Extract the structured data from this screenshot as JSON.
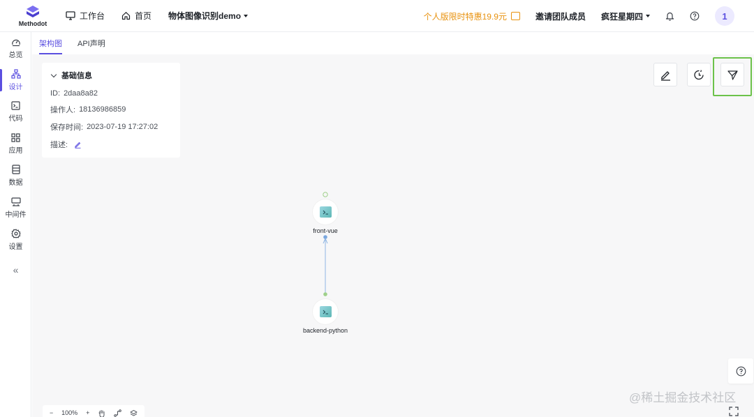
{
  "header": {
    "logo_text": "Methodot",
    "nav": [
      {
        "label": "工作台",
        "icon": "monitor-icon"
      },
      {
        "label": "首页",
        "icon": "home-icon"
      }
    ],
    "project": "物体图像识别demo",
    "promo": "个人版限时特惠19.9元",
    "invite": "邀请团队成员",
    "user_menu": "疯狂星期四",
    "avatar": "1"
  },
  "sidebar": {
    "items": [
      {
        "label": "总览",
        "icon": "dashboard-icon"
      },
      {
        "label": "设计",
        "icon": "architecture-icon"
      },
      {
        "label": "代码",
        "icon": "terminal-icon"
      },
      {
        "label": "应用",
        "icon": "apps-icon"
      },
      {
        "label": "数据",
        "icon": "database-icon"
      },
      {
        "label": "中间件",
        "icon": "middleware-icon"
      },
      {
        "label": "设置",
        "icon": "gear-icon"
      }
    ],
    "active_index": 1,
    "collapse_glyph": "«"
  },
  "tabs": [
    {
      "label": "架构图"
    },
    {
      "label": "API声明"
    }
  ],
  "info_panel": {
    "title": "基础信息",
    "id_label": "ID:",
    "id_value": "2daa8a82",
    "operator_label": "操作人:",
    "operator_value": "18136986859",
    "saved_label": "保存时间:",
    "saved_value": "2023-07-19 17:27:02",
    "desc_label": "描述:"
  },
  "nodes": [
    {
      "label": "front-vue"
    },
    {
      "label": "backend-python"
    }
  ],
  "zoom": {
    "minus": "−",
    "value": "100%",
    "plus": "+"
  },
  "watermark": "@稀土掘金技术社区",
  "colors": {
    "accent": "#5b4fe0",
    "promo": "#e8920f",
    "highlight": "#6cc24a",
    "edge": "#8fb5e3"
  }
}
